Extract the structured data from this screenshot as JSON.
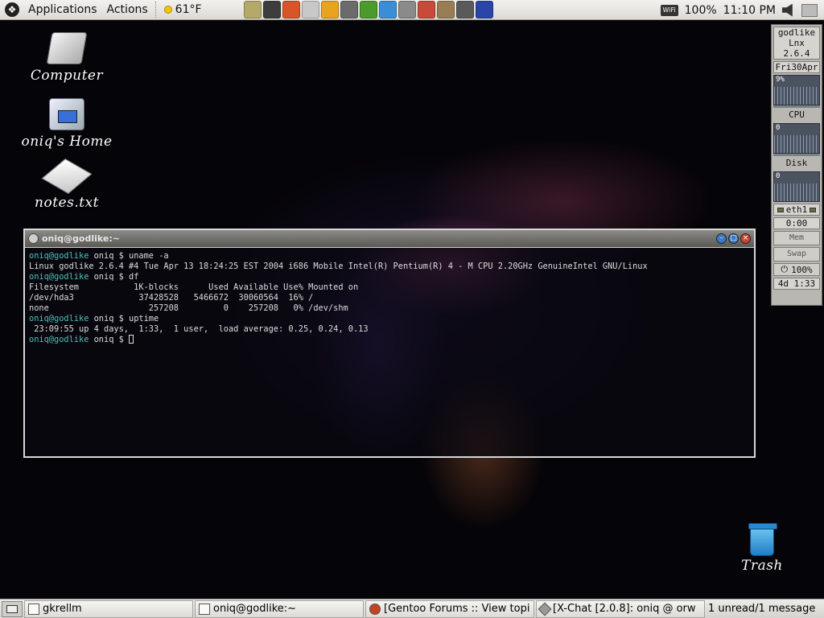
{
  "top_panel": {
    "menus": [
      "Applications",
      "Actions"
    ],
    "weather": "61°F",
    "launcher_icons": [
      "notes-icon",
      "terminal-icon",
      "firefox-icon",
      "drive-icon",
      "gaim-icon",
      "settings-icon",
      "globe-icon",
      "evolution-icon",
      "media-icon",
      "calendar-icon",
      "gimp-icon",
      "mail-icon",
      "text-editor-icon"
    ],
    "launcher_colors": [
      "#b5a96a",
      "#3d3d3d",
      "#d8552a",
      "#c8c8c8",
      "#e8a41e",
      "#6b6b6b",
      "#4b9a2c",
      "#3a8ed6",
      "#8a8a8a",
      "#c84a3a",
      "#9a7d55",
      "#5a5a5a",
      "#2a44a8"
    ],
    "wifi_label": "WiFi",
    "battery": "100%",
    "clock": "11:10 PM"
  },
  "desktop_icons": [
    {
      "label": "Computer"
    },
    {
      "label": "oniq's Home"
    },
    {
      "label": "notes.txt"
    },
    {
      "label": "Trash"
    }
  ],
  "gkrellm": {
    "hostname": "godlike",
    "kernel": "Lnx 2.6.4",
    "date": "Fri30Apr",
    "cpu_value": "9%",
    "cpu_label": "CPU",
    "disk_value": "0",
    "disk_label": "Disk",
    "net_value": "0",
    "net_label": "eth1",
    "net_time": "0:00",
    "mem_label": "Mem",
    "swap_label": "Swap",
    "battery": "100%",
    "uptime": "4d  1:33"
  },
  "terminal": {
    "title": "oniq@godlike:~",
    "lines": [
      {
        "prompt": "oniq@godlike",
        "rest": " oniq $ uname -a"
      },
      {
        "prompt": "",
        "rest": "Linux godlike 2.6.4 #4 Tue Apr 13 18:24:25 EST 2004 i686 Mobile Intel(R) Pentium(R) 4 - M CPU 2.20GHz GenuineIntel GNU/Linux"
      },
      {
        "prompt": "oniq@godlike",
        "rest": " oniq $ df"
      },
      {
        "prompt": "",
        "rest": "Filesystem           1K-blocks      Used Available Use% Mounted on"
      },
      {
        "prompt": "",
        "rest": "/dev/hda3             37428528   5466672  30060564  16% /"
      },
      {
        "prompt": "",
        "rest": "none                    257208         0    257208   0% /dev/shm"
      },
      {
        "prompt": "oniq@godlike",
        "rest": " oniq $ uptime"
      },
      {
        "prompt": "",
        "rest": " 23:09:55 up 4 days,  1:33,  1 user,  load average: 0.25, 0.24, 0.13"
      },
      {
        "prompt": "oniq@godlike",
        "rest": " oniq $ "
      }
    ]
  },
  "taskbar": {
    "tasks": [
      {
        "label": "gkrellm"
      },
      {
        "label": "oniq@godlike:~"
      },
      {
        "label": "[Gentoo Forums :: View topi"
      },
      {
        "label": "[X-Chat [2.0.8]: oniq @ orw"
      }
    ],
    "notification": "1 unread/1 message"
  }
}
